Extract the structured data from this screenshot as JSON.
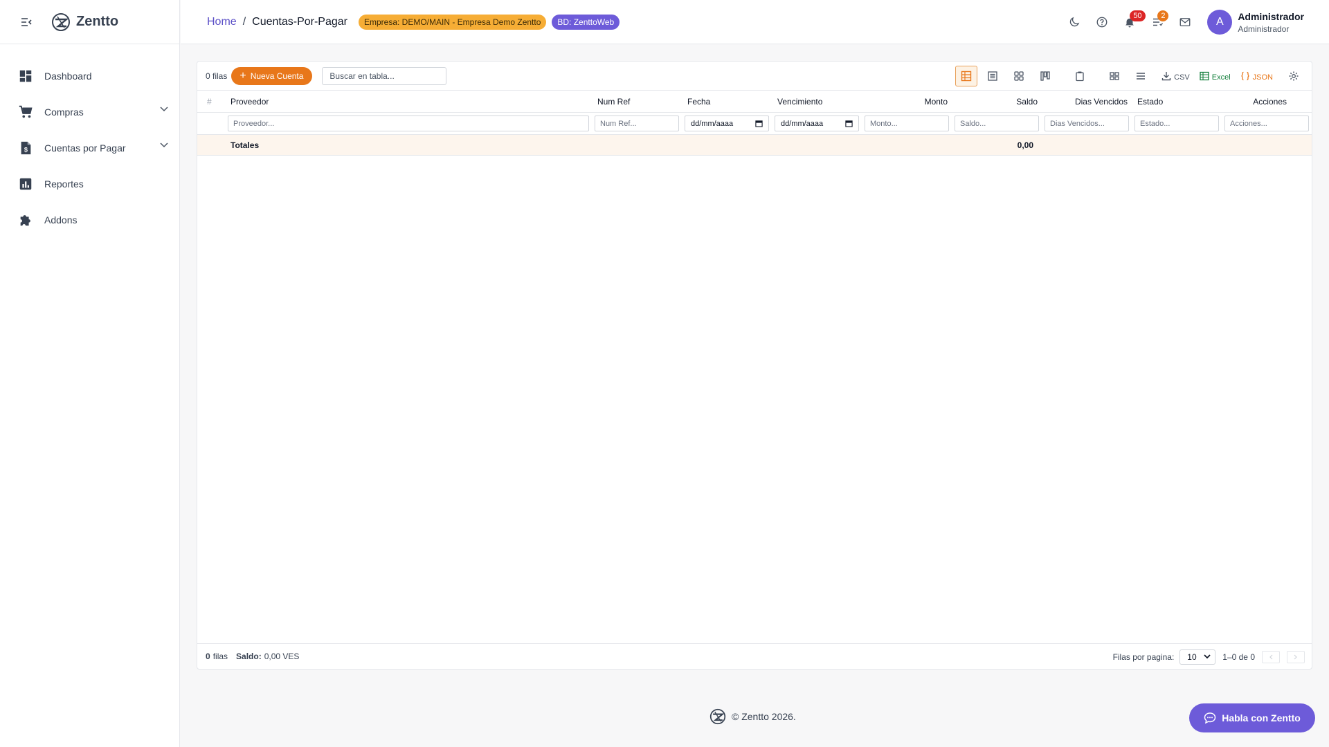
{
  "app": {
    "name": "Zentto"
  },
  "sidebar": {
    "items": [
      {
        "label": "Dashboard",
        "icon": "dashboard-icon",
        "expandable": false
      },
      {
        "label": "Compras",
        "icon": "cart-icon",
        "expandable": true
      },
      {
        "label": "Cuentas por Pagar",
        "icon": "invoice-dollar-icon",
        "expandable": true
      },
      {
        "label": "Reportes",
        "icon": "bar-chart-icon",
        "expandable": false
      },
      {
        "label": "Addons",
        "icon": "puzzle-icon",
        "expandable": false
      }
    ]
  },
  "header": {
    "breadcrumb": {
      "home": "Home",
      "separator": "/",
      "current": "Cuentas-Por-Pagar"
    },
    "badge_empresa": "Empresa: DEMO/MAIN - Empresa Demo Zentto",
    "badge_bd": "BD: ZenttoWeb",
    "notifications_count": "50",
    "tasks_count": "2",
    "user": {
      "initial": "A",
      "name": "Administrador",
      "role": "Administrador"
    }
  },
  "toolbar": {
    "rows_count": "0 filas",
    "new_button": "Nueva Cuenta",
    "search_placeholder": "Buscar en tabla...",
    "export_csv": "CSV",
    "export_excel": "Excel",
    "export_json": "JSON"
  },
  "table": {
    "hash": "#",
    "columns": [
      "Proveedor",
      "Num Ref",
      "Fecha",
      "Vencimiento",
      "Monto",
      "Saldo",
      "Dias Vencidos",
      "Estado",
      "Acciones"
    ],
    "filters": {
      "proveedor": "Proveedor...",
      "num_ref": "Num Ref...",
      "fecha": "dd/mm/aaaa",
      "vencimiento": "dd/mm/aaaa",
      "monto": "Monto...",
      "saldo": "Saldo...",
      "dias_vencidos": "Dias Vencidos...",
      "estado": "Estado...",
      "acciones": "Acciones..."
    },
    "totals_label": "Totales",
    "totals_saldo": "0,00"
  },
  "panel_footer": {
    "count": "0",
    "count_label": "filas",
    "saldo_label": "Saldo:",
    "saldo_value": "0,00 VES",
    "rows_per_page_label": "Filas por pagina:",
    "rows_per_page": "10",
    "range": "1–0 de 0"
  },
  "footer": {
    "copyright": "© Zentto 2026."
  },
  "chat": {
    "label": "Habla con Zentto"
  },
  "colors": {
    "accent": "#e8771a",
    "brand": "#6d5bd9",
    "empresa_badge": "#f6ad35",
    "danger": "#dc2626"
  }
}
